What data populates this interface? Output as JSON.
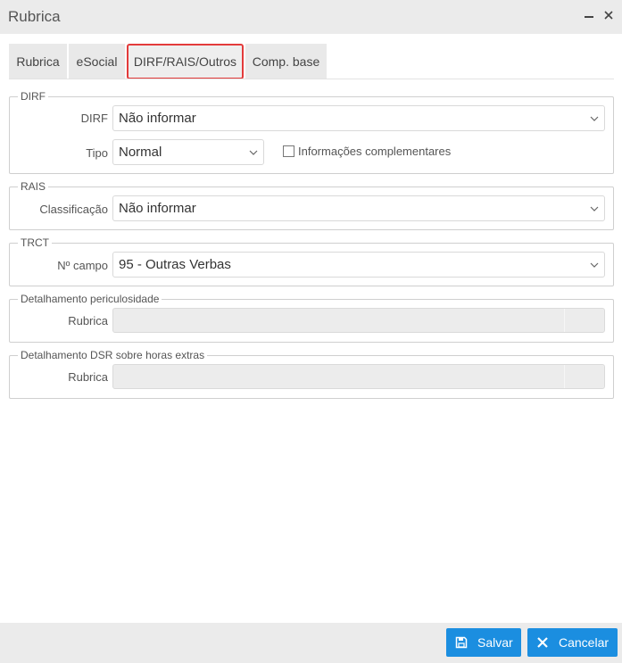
{
  "window": {
    "title": "Rubrica",
    "minimize_icon": "minimize-icon",
    "close_icon": "close-icon"
  },
  "tabs": [
    {
      "label": "Rubrica"
    },
    {
      "label": "eSocial"
    },
    {
      "label": "DIRF/RAIS/Outros",
      "active": true
    },
    {
      "label": "Comp. base"
    }
  ],
  "dirf": {
    "legend": "DIRF",
    "dirf_label": "DIRF",
    "dirf_value": "Não informar",
    "tipo_label": "Tipo",
    "tipo_value": "Normal",
    "info_comp_label": "Informações complementares",
    "info_comp_checked": false
  },
  "rais": {
    "legend": "RAIS",
    "classificacao_label": "Classificação",
    "classificacao_value": "Não informar"
  },
  "trct": {
    "legend": "TRCT",
    "campo_label": "Nº campo",
    "campo_value": "95 - Outras Verbas"
  },
  "periculosidade": {
    "legend": "Detalhamento periculosidade",
    "rubrica_label": "Rubrica",
    "rubrica_value": ""
  },
  "dsr": {
    "legend": "Detalhamento DSR sobre horas extras",
    "rubrica_label": "Rubrica",
    "rubrica_value": ""
  },
  "footer": {
    "save_label": "Salvar",
    "cancel_label": "Cancelar"
  },
  "colors": {
    "accent": "#1b8ee0",
    "active_tab_border": "#e33b3b"
  }
}
